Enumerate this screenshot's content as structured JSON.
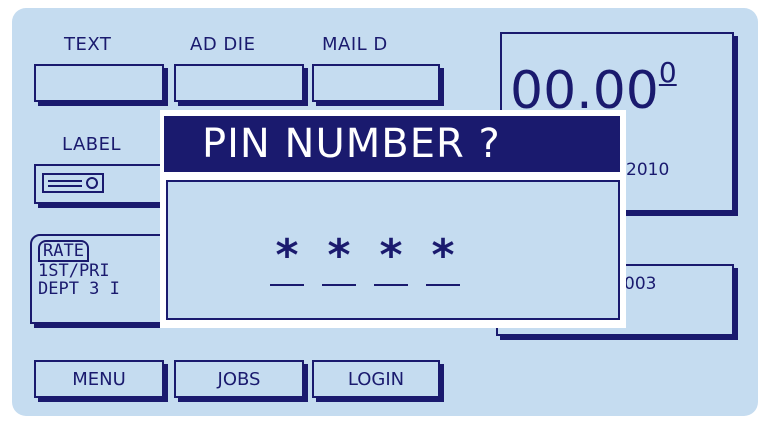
{
  "screen": {
    "softkeys_top": [
      {
        "label": "TEXT"
      },
      {
        "label": "AD DIE"
      },
      {
        "label": "MAIL D"
      }
    ],
    "label_key": {
      "label": "LABEL",
      "icon": "label-tape-icon"
    },
    "postage_amount": {
      "main": "00.00",
      "superscript": "0"
    },
    "date": "2010",
    "rate": {
      "tag": "RATE",
      "line1": "1ST/PRI",
      "line2": "DEPT 3 I"
    },
    "account_partial": "003",
    "softkeys_bottom": [
      {
        "label": "MENU"
      },
      {
        "label": "JOBS"
      },
      {
        "label": "LOGIN"
      }
    ]
  },
  "dialog": {
    "title": "PIN NUMBER ?",
    "pin_mask": [
      "*",
      "*",
      "*",
      "*"
    ]
  },
  "colors": {
    "lcd_background": "#c5dcf0",
    "ink": "#1a1a6e",
    "dialog_title_bg": "#1a1a6e",
    "dialog_title_fg": "#ffffff"
  }
}
